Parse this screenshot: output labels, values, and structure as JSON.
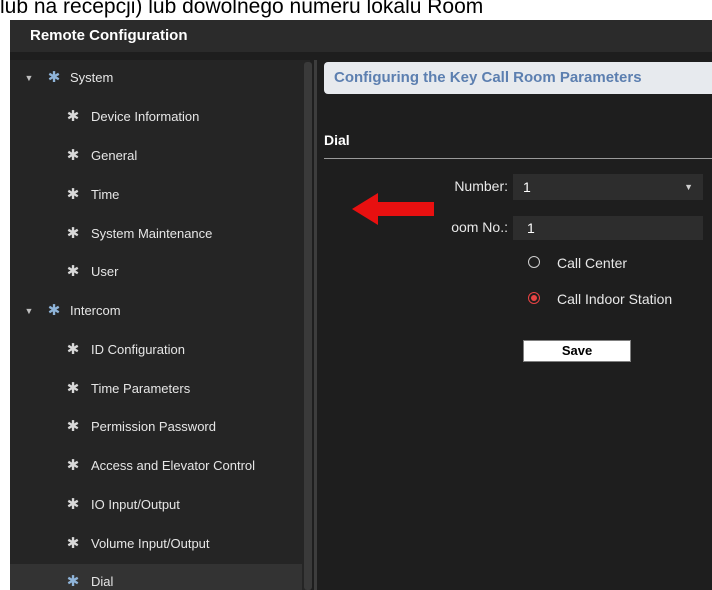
{
  "caption": "lub na recepcji) lub dowolnego numeru lokalu Room",
  "window": {
    "title": "Remote Configuration"
  },
  "sidebar": {
    "items": [
      {
        "label": "System",
        "level": 0,
        "expanded": true,
        "icon": "gear-icon"
      },
      {
        "label": "Device Information",
        "level": 1,
        "icon": "gear-icon"
      },
      {
        "label": "General",
        "level": 1,
        "icon": "gear-icon"
      },
      {
        "label": "Time",
        "level": 1,
        "icon": "gear-icon"
      },
      {
        "label": "System Maintenance",
        "level": 1,
        "icon": "gear-icon"
      },
      {
        "label": "User",
        "level": 1,
        "icon": "gear-icon"
      },
      {
        "label": "Intercom",
        "level": 0,
        "expanded": true,
        "icon": "gear-icon"
      },
      {
        "label": "ID Configuration",
        "level": 1,
        "icon": "gear-icon"
      },
      {
        "label": "Time Parameters",
        "level": 1,
        "icon": "gear-icon"
      },
      {
        "label": "Permission Password",
        "level": 1,
        "icon": "gear-icon"
      },
      {
        "label": "Access and Elevator Control",
        "level": 1,
        "icon": "gear-icon"
      },
      {
        "label": "IO Input/Output",
        "level": 1,
        "icon": "gear-icon"
      },
      {
        "label": "Volume Input/Output",
        "level": 1,
        "icon": "gear-icon"
      },
      {
        "label": "Dial",
        "level": 1,
        "selected": true,
        "icon": "gear-icon"
      }
    ]
  },
  "main": {
    "header": "Configuring the Key Call Room Parameters",
    "section": "Dial",
    "form": {
      "number_label": "Number:",
      "number_value": "1",
      "room_label": "oom No.:",
      "room_value": "1",
      "radio_call_center": "Call Center",
      "radio_call_indoor": "Call Indoor Station",
      "selected_radio": "Call Indoor Station",
      "save_label": "Save"
    }
  },
  "colors": {
    "annotation_arrow": "#e81010",
    "radio_checked": "#e84343",
    "header_text": "#5c7fb0"
  }
}
